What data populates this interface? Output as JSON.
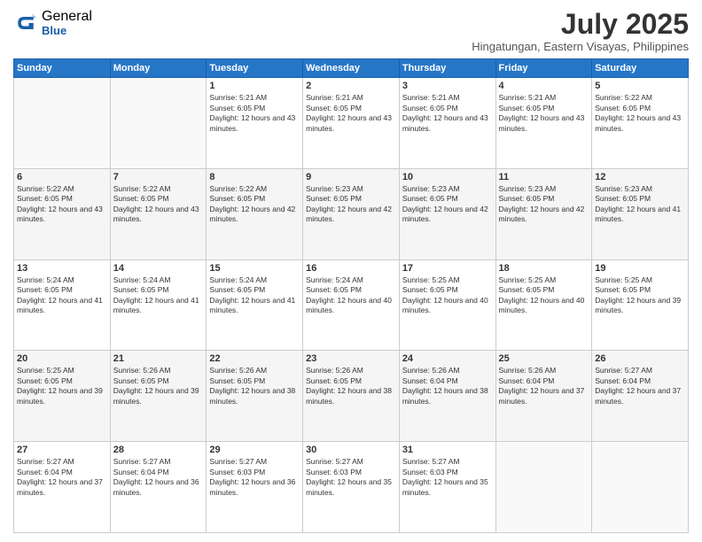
{
  "logo": {
    "general": "General",
    "blue": "Blue"
  },
  "header": {
    "month_year": "July 2025",
    "location": "Hingatungan, Eastern Visayas, Philippines"
  },
  "days_of_week": [
    "Sunday",
    "Monday",
    "Tuesday",
    "Wednesday",
    "Thursday",
    "Friday",
    "Saturday"
  ],
  "weeks": [
    [
      {
        "day": "",
        "info": ""
      },
      {
        "day": "",
        "info": ""
      },
      {
        "day": "1",
        "info": "Sunrise: 5:21 AM\nSunset: 6:05 PM\nDaylight: 12 hours and 43 minutes."
      },
      {
        "day": "2",
        "info": "Sunrise: 5:21 AM\nSunset: 6:05 PM\nDaylight: 12 hours and 43 minutes."
      },
      {
        "day": "3",
        "info": "Sunrise: 5:21 AM\nSunset: 6:05 PM\nDaylight: 12 hours and 43 minutes."
      },
      {
        "day": "4",
        "info": "Sunrise: 5:21 AM\nSunset: 6:05 PM\nDaylight: 12 hours and 43 minutes."
      },
      {
        "day": "5",
        "info": "Sunrise: 5:22 AM\nSunset: 6:05 PM\nDaylight: 12 hours and 43 minutes."
      }
    ],
    [
      {
        "day": "6",
        "info": "Sunrise: 5:22 AM\nSunset: 6:05 PM\nDaylight: 12 hours and 43 minutes."
      },
      {
        "day": "7",
        "info": "Sunrise: 5:22 AM\nSunset: 6:05 PM\nDaylight: 12 hours and 43 minutes."
      },
      {
        "day": "8",
        "info": "Sunrise: 5:22 AM\nSunset: 6:05 PM\nDaylight: 12 hours and 42 minutes."
      },
      {
        "day": "9",
        "info": "Sunrise: 5:23 AM\nSunset: 6:05 PM\nDaylight: 12 hours and 42 minutes."
      },
      {
        "day": "10",
        "info": "Sunrise: 5:23 AM\nSunset: 6:05 PM\nDaylight: 12 hours and 42 minutes."
      },
      {
        "day": "11",
        "info": "Sunrise: 5:23 AM\nSunset: 6:05 PM\nDaylight: 12 hours and 42 minutes."
      },
      {
        "day": "12",
        "info": "Sunrise: 5:23 AM\nSunset: 6:05 PM\nDaylight: 12 hours and 41 minutes."
      }
    ],
    [
      {
        "day": "13",
        "info": "Sunrise: 5:24 AM\nSunset: 6:05 PM\nDaylight: 12 hours and 41 minutes."
      },
      {
        "day": "14",
        "info": "Sunrise: 5:24 AM\nSunset: 6:05 PM\nDaylight: 12 hours and 41 minutes."
      },
      {
        "day": "15",
        "info": "Sunrise: 5:24 AM\nSunset: 6:05 PM\nDaylight: 12 hours and 41 minutes."
      },
      {
        "day": "16",
        "info": "Sunrise: 5:24 AM\nSunset: 6:05 PM\nDaylight: 12 hours and 40 minutes."
      },
      {
        "day": "17",
        "info": "Sunrise: 5:25 AM\nSunset: 6:05 PM\nDaylight: 12 hours and 40 minutes."
      },
      {
        "day": "18",
        "info": "Sunrise: 5:25 AM\nSunset: 6:05 PM\nDaylight: 12 hours and 40 minutes."
      },
      {
        "day": "19",
        "info": "Sunrise: 5:25 AM\nSunset: 6:05 PM\nDaylight: 12 hours and 39 minutes."
      }
    ],
    [
      {
        "day": "20",
        "info": "Sunrise: 5:25 AM\nSunset: 6:05 PM\nDaylight: 12 hours and 39 minutes."
      },
      {
        "day": "21",
        "info": "Sunrise: 5:26 AM\nSunset: 6:05 PM\nDaylight: 12 hours and 39 minutes."
      },
      {
        "day": "22",
        "info": "Sunrise: 5:26 AM\nSunset: 6:05 PM\nDaylight: 12 hours and 38 minutes."
      },
      {
        "day": "23",
        "info": "Sunrise: 5:26 AM\nSunset: 6:05 PM\nDaylight: 12 hours and 38 minutes."
      },
      {
        "day": "24",
        "info": "Sunrise: 5:26 AM\nSunset: 6:04 PM\nDaylight: 12 hours and 38 minutes."
      },
      {
        "day": "25",
        "info": "Sunrise: 5:26 AM\nSunset: 6:04 PM\nDaylight: 12 hours and 37 minutes."
      },
      {
        "day": "26",
        "info": "Sunrise: 5:27 AM\nSunset: 6:04 PM\nDaylight: 12 hours and 37 minutes."
      }
    ],
    [
      {
        "day": "27",
        "info": "Sunrise: 5:27 AM\nSunset: 6:04 PM\nDaylight: 12 hours and 37 minutes."
      },
      {
        "day": "28",
        "info": "Sunrise: 5:27 AM\nSunset: 6:04 PM\nDaylight: 12 hours and 36 minutes."
      },
      {
        "day": "29",
        "info": "Sunrise: 5:27 AM\nSunset: 6:03 PM\nDaylight: 12 hours and 36 minutes."
      },
      {
        "day": "30",
        "info": "Sunrise: 5:27 AM\nSunset: 6:03 PM\nDaylight: 12 hours and 35 minutes."
      },
      {
        "day": "31",
        "info": "Sunrise: 5:27 AM\nSunset: 6:03 PM\nDaylight: 12 hours and 35 minutes."
      },
      {
        "day": "",
        "info": ""
      },
      {
        "day": "",
        "info": ""
      }
    ]
  ]
}
